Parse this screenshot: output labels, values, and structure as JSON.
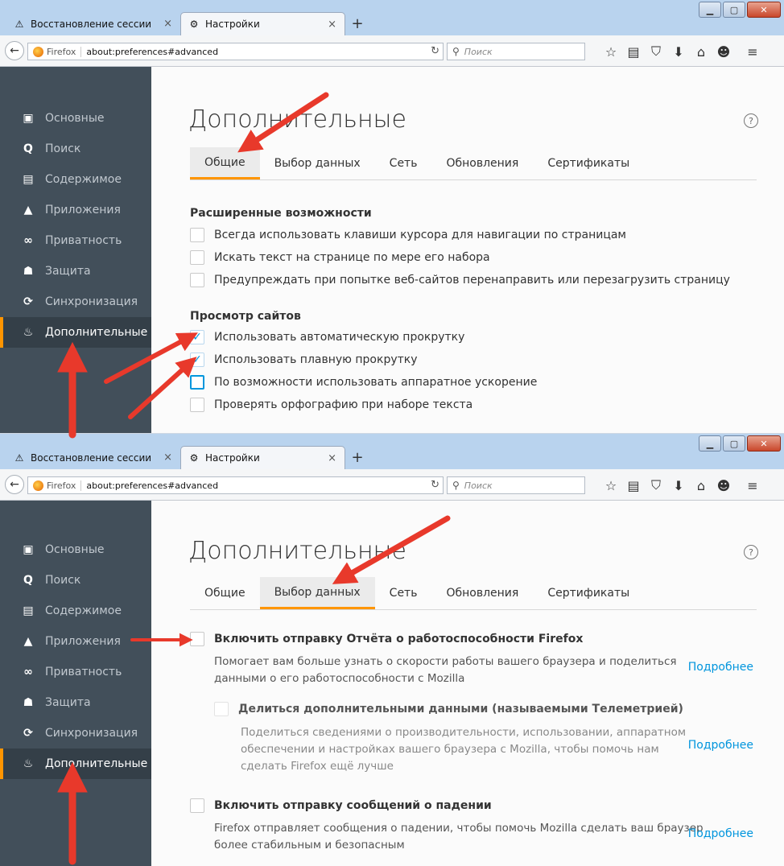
{
  "browser": {
    "tabs": [
      {
        "label": "Восстановление сессии",
        "icon": "warning-icon"
      },
      {
        "label": "Настройки",
        "icon": "gear-icon"
      }
    ],
    "firefox_label": "Firefox",
    "url": "about:preferences#advanced",
    "search_placeholder": "Поиск",
    "toolbar_icons": [
      "star-icon",
      "reading-list-icon",
      "pocket-icon",
      "download-icon",
      "home-icon",
      "hello-icon",
      "menu-icon"
    ]
  },
  "sidebar": {
    "items": [
      {
        "label": "Основные",
        "icon": "general-icon"
      },
      {
        "label": "Поиск",
        "icon": "search-icon"
      },
      {
        "label": "Содержимое",
        "icon": "content-icon"
      },
      {
        "label": "Приложения",
        "icon": "applications-icon"
      },
      {
        "label": "Приватность",
        "icon": "privacy-mask-icon"
      },
      {
        "label": "Защита",
        "icon": "lock-icon"
      },
      {
        "label": "Синхронизация",
        "icon": "sync-icon"
      },
      {
        "label": "Дополнительные",
        "icon": "advanced-icon"
      }
    ],
    "active_index": 7
  },
  "page": {
    "title": "Дополнительные",
    "help": "?",
    "subtabs": [
      "Общие",
      "Выбор данных",
      "Сеть",
      "Обновления",
      "Сертификаты"
    ]
  },
  "shot1": {
    "selected_subtab": 0,
    "groups": [
      {
        "title": "Расширенные возможности",
        "options": [
          {
            "label": "Всегда использовать клавиши курсора для навигации по страницам",
            "checked": false
          },
          {
            "label": "Искать текст на странице по мере его набора",
            "checked": false
          },
          {
            "label": "Предупреждать при попытке веб-сайтов перенаправить или перезагрузить страницу",
            "checked": false
          }
        ]
      },
      {
        "title": "Просмотр сайтов",
        "options": [
          {
            "label": "Использовать автоматическую прокрутку",
            "checked": true
          },
          {
            "label": "Использовать плавную прокрутку",
            "checked": true
          },
          {
            "label": "По возможности использовать аппаратное ускорение",
            "checked": false
          },
          {
            "label": "Проверять орфографию при наборе текста",
            "checked": false
          }
        ]
      }
    ]
  },
  "shot2": {
    "selected_subtab": 1,
    "sections": [
      {
        "label": "Включить отправку Отчёта о работоспособности Firefox",
        "description": [
          "Помогает вам больше узнать о скорости работы вашего браузера и поделиться",
          "данными о его работоспособности с Mozilla"
        ],
        "link": "Подробнее",
        "checked": false
      },
      {
        "label": "Делиться дополнительными данными (называемыми Телеметрией)",
        "description": [
          "Поделиться сведениями о производительности, использовании, аппаратном",
          "обеспечении и настройках вашего браузера с Mozilla, чтобы помочь нам",
          "сделать Firefox ещё лучше"
        ],
        "link": "Подробнее",
        "checked": false
      },
      {
        "label": "Включить отправку сообщений о падении",
        "description": [
          "Firefox отправляет сообщения о падении, чтобы помочь Mozilla сделать ваш браузер",
          "более стабильным и безопасным"
        ],
        "link": "Подробнее",
        "checked": false
      }
    ]
  },
  "colors": {
    "accent": "#ff9500",
    "sidebar_bg": "#424f5a",
    "link": "#0095dd",
    "annotation_arrow": "#e8392b"
  }
}
